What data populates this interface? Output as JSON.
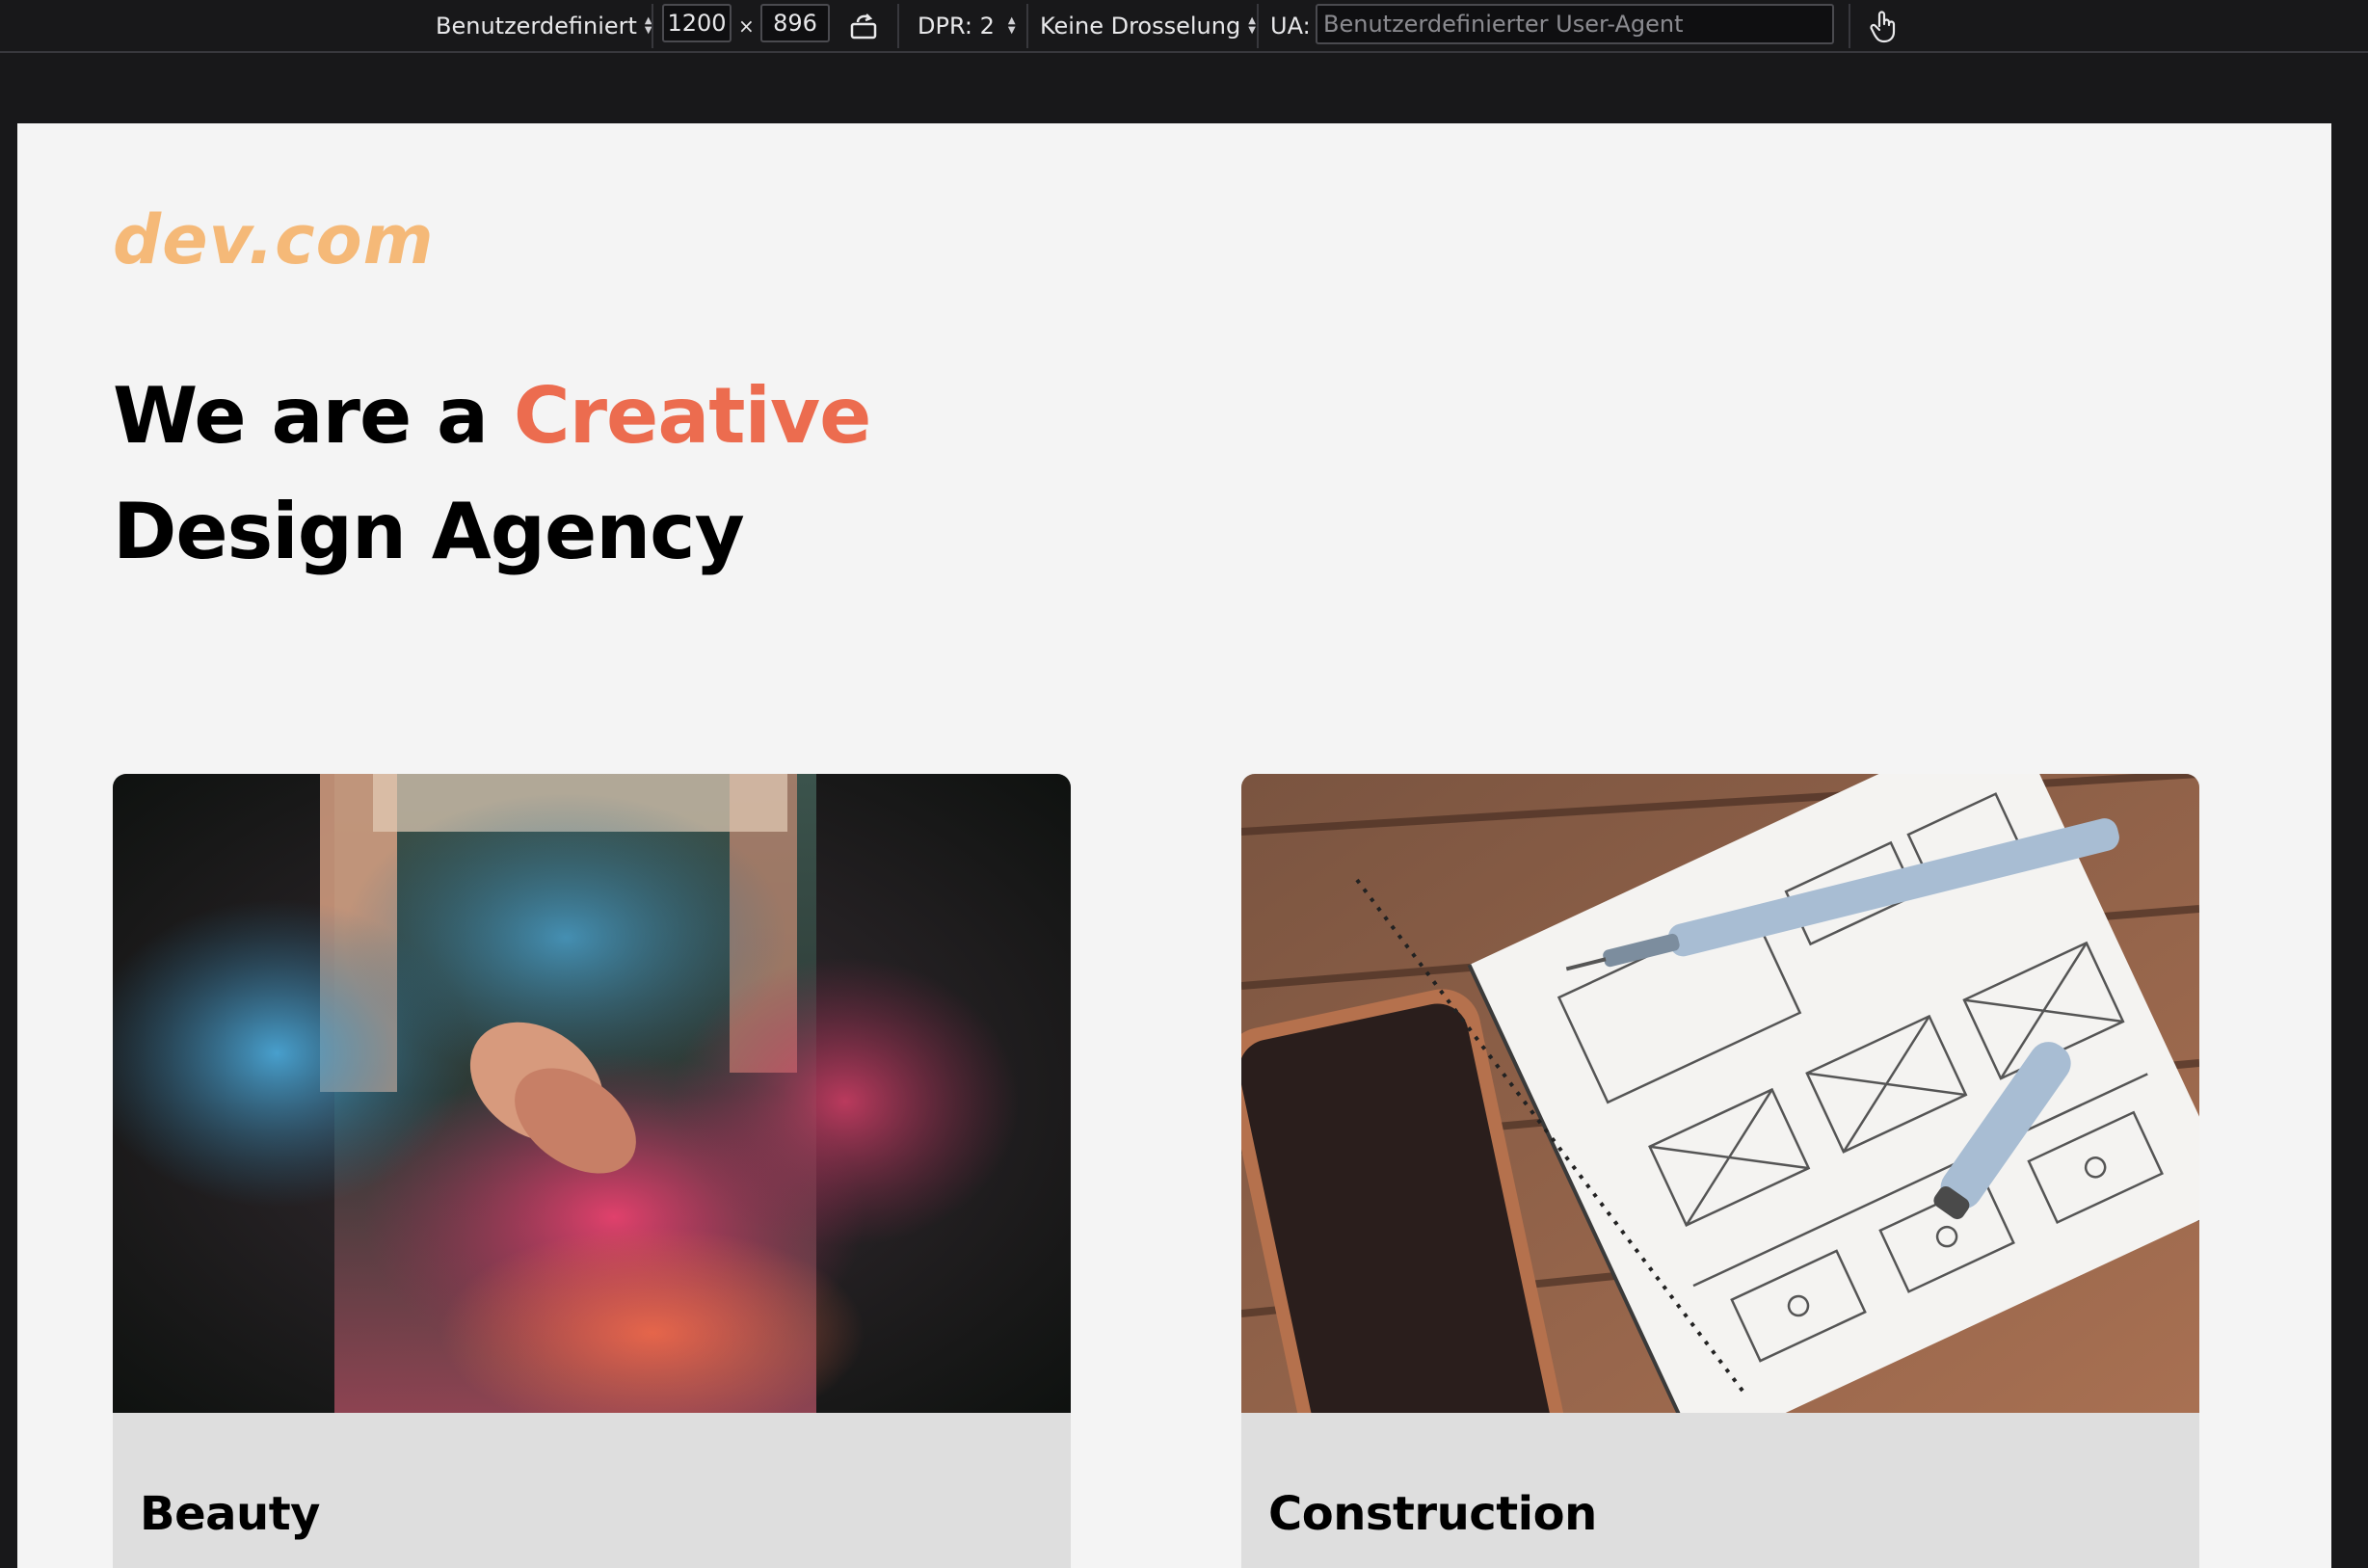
{
  "toolbar": {
    "device_label": "Benutzerdefiniert",
    "width_value": "1200",
    "times_symbol": "×",
    "height_value": "896",
    "dpr_label": "DPR: 2",
    "throttle_label": "Keine Drosselung",
    "ua_label": "UA:",
    "ua_placeholder": "Benutzerdefinierter User-Agent"
  },
  "page": {
    "logo": "dev.com",
    "headline_part1": "We are a ",
    "headline_accent": "Creative",
    "headline_line2": "Design Agency",
    "cards": [
      {
        "title": "Beauty"
      },
      {
        "title": "Construction"
      }
    ]
  },
  "colors": {
    "logo": "#f5b978",
    "accent": "#ec6c4f",
    "page_background": "#f4f4f4",
    "card_background": "#dedede",
    "toolbar_background": "#18181a"
  }
}
